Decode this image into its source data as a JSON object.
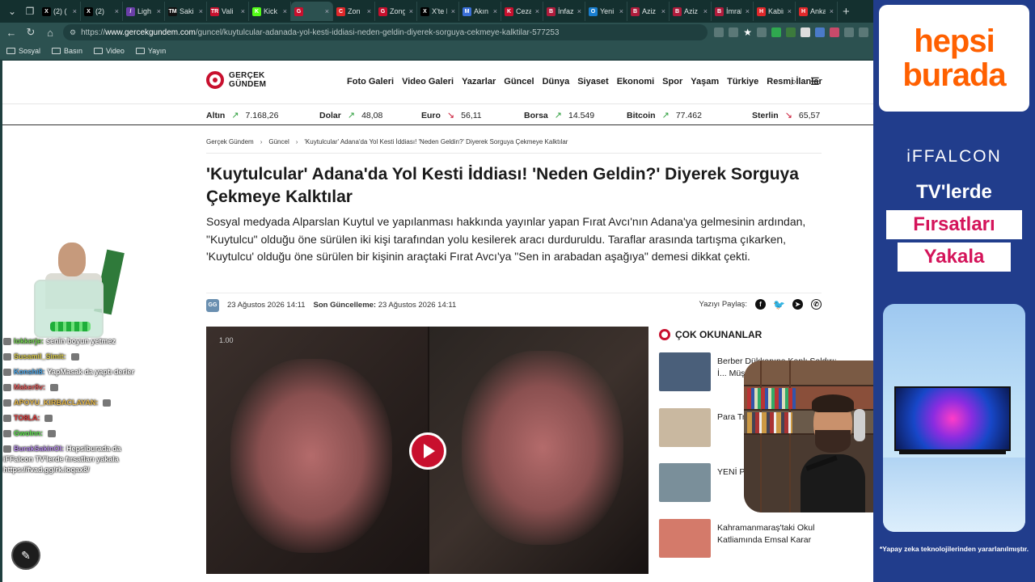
{
  "browser": {
    "tabs": [
      {
        "label": "(2) ( ",
        "fav": "X",
        "color": "#000000"
      },
      {
        "label": "(2) ",
        "fav": "X",
        "color": "#000000"
      },
      {
        "label": "Ligh",
        "fav": "/",
        "color": "#6a3fa8"
      },
      {
        "label": "Saki",
        "fav": "TM",
        "color": "#111111"
      },
      {
        "label": "Vali",
        "fav": "TR",
        "color": "#c8102e"
      },
      {
        "label": "Kick",
        "fav": "K",
        "color": "#53fc18"
      },
      {
        "label": "",
        "fav": "G",
        "color": "#c8102e",
        "active": true
      },
      {
        "label": "Zon",
        "fav": "C",
        "color": "#e0282a"
      },
      {
        "label": "Zongul",
        "fav": "G",
        "color": "#c8102e"
      },
      {
        "label": "X'te Dü",
        "fav": "X",
        "color": "#000000"
      },
      {
        "label": "Akın Gü",
        "fav": "M",
        "color": "#3a6fd8"
      },
      {
        "label": "Ceza inf",
        "fav": "K",
        "color": "#c8102e"
      },
      {
        "label": "İnfaz sis",
        "fav": "B",
        "color": "#b01c3c"
      },
      {
        "label": "Yeni Par",
        "fav": "O",
        "color": "#1a7fd0"
      },
      {
        "label": "Aziz İhs",
        "fav": "B",
        "color": "#b01c3c"
      },
      {
        "label": "Aziz İhsa",
        "fav": "B",
        "color": "#b01c3c"
      },
      {
        "label": "İmralı S",
        "fav": "B",
        "color": "#b01c3c"
      },
      {
        "label": "Kabine",
        "fav": "H",
        "color": "#e0282a"
      },
      {
        "label": "Ankara",
        "fav": "H",
        "color": "#e0282a"
      }
    ],
    "url_prefix": "https://",
    "url_host": "www.gercekgundem.com",
    "url_path": "/guncel/kuytulcular-adanada-yol-kesti-iddiasi-neden-geldin-diyerek-sorguya-cekmeye-kalktilar-577253",
    "bookmarks": [
      "Sosyal",
      "Basın",
      "Video",
      "Yayın"
    ]
  },
  "site": {
    "logo_line1": "GERÇEK",
    "logo_line2": "GÜNDEM",
    "nav": [
      "Foto Galeri",
      "Video Galeri",
      "Yazarlar",
      "Güncel",
      "Dünya",
      "Siyaset",
      "Ekonomi",
      "Spor",
      "Yaşam",
      "Türkiye",
      "Resmi İlanlar"
    ],
    "ticker": [
      {
        "name": "Altın",
        "value": "7.168,26",
        "dir": "up"
      },
      {
        "name": "Dolar",
        "value": "48,08",
        "dir": "up"
      },
      {
        "name": "Euro",
        "value": "56,11",
        "dir": "down"
      },
      {
        "name": "Borsa",
        "value": "14.549",
        "dir": "up"
      },
      {
        "name": "Bitcoin",
        "value": "77.462",
        "dir": "up"
      },
      {
        "name": "Sterlin",
        "value": "65,57",
        "dir": "down"
      }
    ]
  },
  "article": {
    "breadcrumb": [
      "Gerçek Gündem",
      "Güncel",
      "'Kuytulcular' Adana'da Yol Kesti İddiası! 'Neden Geldin?' Diyerek Sorguya Çekmeye Kalktılar"
    ],
    "title": "'Kuytulcular' Adana'da Yol Kesti İddiası! 'Neden Geldin?' Diyerek Sorguya Çekmeye Kalktılar",
    "summary": "Sosyal medyada Alparslan Kuytul ve yapılanması hakkında yayınlar yapan Fırat Avcı'nın Adana'ya gelmesinin ardından, \"Kuytulcu\" olduğu öne sürülen iki kişi tarafından yolu kesilerek aracı durduruldu. Taraflar arasında tartışma çıkarken, 'Kuytulcu' olduğu öne sürülen bir kişinin araçtaki Fırat Avcı'ya \"Sen in arabadan aşağıya\" demesi dikkat çekti.",
    "badge": "GG",
    "published": "23 Ağustos 2026 14:11",
    "updated_label": "Son Güncelleme:",
    "updated": "23 Ağustos 2026 14:11",
    "share_label": "Yazıyı Paylaş:",
    "video_tag": "1.00"
  },
  "most_read": {
    "title": "ÇOK OKUNANLAR",
    "items": [
      {
        "text": "Berber Dükkanına Kanlı Saldırı: İ... Müşter...",
        "thumb": "#4a5f7a"
      },
      {
        "text": "Para Tr... Dönem...",
        "thumb": "#c9b8a0"
      },
      {
        "text": "YENİ P... Hakkın...",
        "thumb": "#7a8f9a"
      },
      {
        "text": "Kahramanmaraş'taki Okul Katliamında Emsal Karar",
        "thumb": "#d47a6a"
      }
    ]
  },
  "chat": [
    {
      "user": "lokkerje:",
      "msg": "senin boyun yetmez",
      "cls": "u1"
    },
    {
      "user": "Susamil_Simit:",
      "msg": "",
      "cls": "u2"
    },
    {
      "user": "Konshi8:",
      "msg": "YapMasak da yaptı derler",
      "cls": "u3"
    },
    {
      "user": "Maker8v:",
      "msg": "",
      "cls": "u4"
    },
    {
      "user": "APOYU_KIRBACLAYAN:",
      "msg": "",
      "cls": "u5"
    },
    {
      "user": "TO8LA:",
      "msg": "",
      "cls": "u6"
    },
    {
      "user": "Gwolnn:",
      "msg": "",
      "cls": "u7"
    },
    {
      "user": "BurakSakinOl:",
      "msg": "Hepsiburada da iFFalcon TV'lerde fırsatları yakala https://fvad.gg/rk.loqax8/",
      "cls": "u8"
    }
  ],
  "ad": {
    "logo_line1": "hepsi",
    "logo_line2": "burada",
    "brand": "iFFALCON",
    "line1": "TV'lerde",
    "chip1": "Fırsatları",
    "chip2": "Yakala",
    "footnote": "*Yapay zeka teknolojilerinden yararlanılmıştır."
  },
  "colors": {
    "brand_red": "#c8102e",
    "ad_orange": "#ff6000",
    "ad_pink": "#d4145a",
    "chrome_teal": "#2c5150"
  }
}
